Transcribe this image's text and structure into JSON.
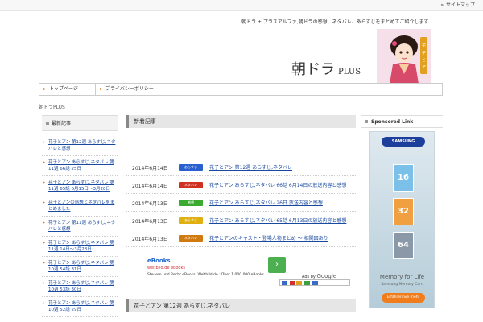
{
  "topbar": {
    "sitemap_label": "サイトマップ"
  },
  "header": {
    "tagline": "朝ドラ + プラスアルファ,朝ドラの感想、ネタバレ、あらすじをまとめてご紹介します",
    "logo_main": "朝ドラ",
    "logo_plus": "PLUS"
  },
  "nav": {
    "items": [
      {
        "label": "トップページ"
      },
      {
        "label": "プライバシーポリシー"
      }
    ]
  },
  "breadcrumb": "朝ドラPLUS",
  "left_sidebar": {
    "heading": "最新記事",
    "items": [
      "花子とアン 第12週 あらすじ,ネタバレと感想",
      "花子とアン あらすじ,ネタバレ 第11週 66話 25日",
      "花子とアン あらすじ,ネタバレ 第11週 65話 6月15日～3月28日",
      "花子とアンの感想とネタバレをまとめました",
      "花子とアン 第11週 あらすじ,ネタバレと感想",
      "花子とアン あらすじ,ネタバレ 第11週 14日～3月28日",
      "花子とアン あらすじ,ネタバレ 第10週 54話 31日",
      "花子とアン あらすじ,ネタバレ 第10週 53話 30日",
      "花子とアン あらすじ,ネタバレ 第10週 52話 29日"
    ]
  },
  "main": {
    "heading": "新着記事",
    "posts": [
      {
        "date": "2014年6月14日",
        "badge": "あらすじ",
        "badge_color": "#2a5fd0",
        "title": "花子とアン 第12週 あらすじ,ネタバレ"
      },
      {
        "date": "2014年6月14日",
        "badge": "ネタバレ",
        "badge_color": "#d03020",
        "title": "花子とアン あらすじ,ネタバレ 66話 6月14日の放送内容と感想"
      },
      {
        "date": "2014年6月13日",
        "badge": "感想",
        "badge_color": "#3aaa30",
        "title": "花子とアン あらすじ,ネタバレ 26日 放送内容と感想"
      },
      {
        "date": "2014年6月13日",
        "badge": "あらすじ",
        "badge_color": "#e0b010",
        "title": "花子とアン あらすじ,ネタバレ 65話 6月13日の放送内容と感想"
      },
      {
        "date": "2014年6月13日",
        "badge": "ネタバレ",
        "badge_color": "#d07a10",
        "title": "花子とアンのキャスト・登場人物まとめ ～ 相関図あり"
      }
    ],
    "ad": {
      "title": "eBooks",
      "subtitle": "weltbild.de ebooks",
      "description": "Steuern und Recht eBooks. Weltbild.de : Über 1.000.000 eBooks",
      "adsby": "Ads by",
      "google": "Google",
      "go_symbol": "›"
    },
    "section_heading": "花子とアン 第12週 あらすじ,ネタバレ"
  },
  "right_sidebar": {
    "heading": "Sponsored Link",
    "banner": {
      "brand": "SAMSUNG",
      "cards": [
        "16",
        "32",
        "64"
      ],
      "tagline": "Memory for Life",
      "subline": "Samsung Memory Card",
      "cta": "Erfahren Sie mehr"
    }
  }
}
